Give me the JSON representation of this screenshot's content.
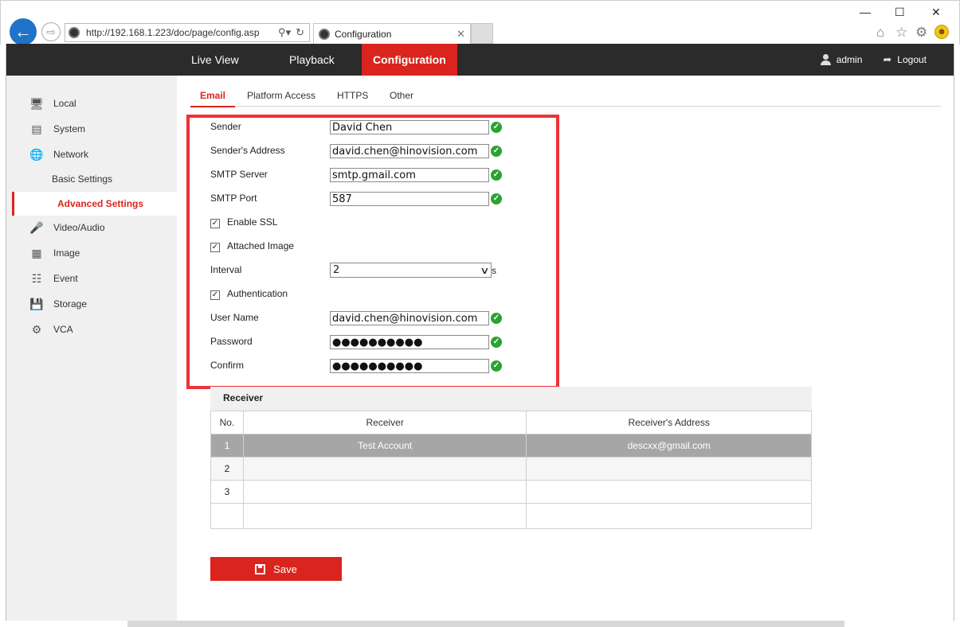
{
  "browser": {
    "url": "http://192.168.1.223/doc/page/config.asp",
    "tab_title": "Configuration",
    "icons": [
      "back-icon",
      "forward-icon",
      "search-icon",
      "refresh-icon",
      "home-icon",
      "star-icon",
      "settings-icon",
      "smiley-icon"
    ]
  },
  "topnav": {
    "items": [
      {
        "label": "Live View"
      },
      {
        "label": "Playback"
      },
      {
        "label": "Configuration",
        "active": true
      }
    ],
    "user": "admin",
    "logout": "Logout"
  },
  "sidebar": {
    "items": [
      {
        "label": "Local",
        "icon": "monitor-icon"
      },
      {
        "label": "System",
        "icon": "system-icon"
      },
      {
        "label": "Network",
        "icon": "globe-icon"
      },
      {
        "label": "Basic Settings"
      },
      {
        "label": "Advanced Settings",
        "active": true
      },
      {
        "label": "Video/Audio",
        "icon": "microphone-icon"
      },
      {
        "label": "Image",
        "icon": "image-icon"
      },
      {
        "label": "Event",
        "icon": "calendar-icon"
      },
      {
        "label": "Storage",
        "icon": "storage-icon"
      },
      {
        "label": "VCA",
        "icon": "vca-icon"
      }
    ]
  },
  "subtabs": [
    {
      "label": "Email",
      "active": true
    },
    {
      "label": "Platform Access"
    },
    {
      "label": "HTTPS"
    },
    {
      "label": "Other"
    }
  ],
  "email_form": {
    "sender_label": "Sender",
    "sender_value": "David Chen",
    "sender_address_label": "Sender's Address",
    "sender_address_value": "david.chen@hinovision.com",
    "smtp_server_label": "SMTP Server",
    "smtp_server_value": "smtp.gmail.com",
    "smtp_port_label": "SMTP Port",
    "smtp_port_value": "587",
    "enable_ssl_label": "Enable SSL",
    "enable_ssl": true,
    "attached_image_label": "Attached Image",
    "attached_image": true,
    "interval_label": "Interval",
    "interval_value": "2",
    "interval_unit": "s",
    "authentication_label": "Authentication",
    "authentication": true,
    "username_label": "User Name",
    "username_value": "david.chen@hinovision.com",
    "password_label": "Password",
    "password_value": "●●●●●●●●●●",
    "confirm_label": "Confirm",
    "confirm_value": "●●●●●●●●●●"
  },
  "receiver": {
    "title": "Receiver",
    "columns": [
      "No.",
      "Receiver",
      "Receiver's Address"
    ],
    "rows": [
      {
        "no": "1",
        "name": "Test Account",
        "address": "descxx@gmail.com"
      },
      {
        "no": "2",
        "name": "",
        "address": ""
      },
      {
        "no": "3",
        "name": "",
        "address": ""
      },
      {
        "no": "",
        "name": "",
        "address": ""
      }
    ]
  },
  "save_label": "Save",
  "colors": {
    "accent": "#d9251d",
    "topbar": "#2b2b2b",
    "sidebar": "#f0f0f0",
    "highlight": "#ee3237",
    "ok": "#2aa332"
  }
}
